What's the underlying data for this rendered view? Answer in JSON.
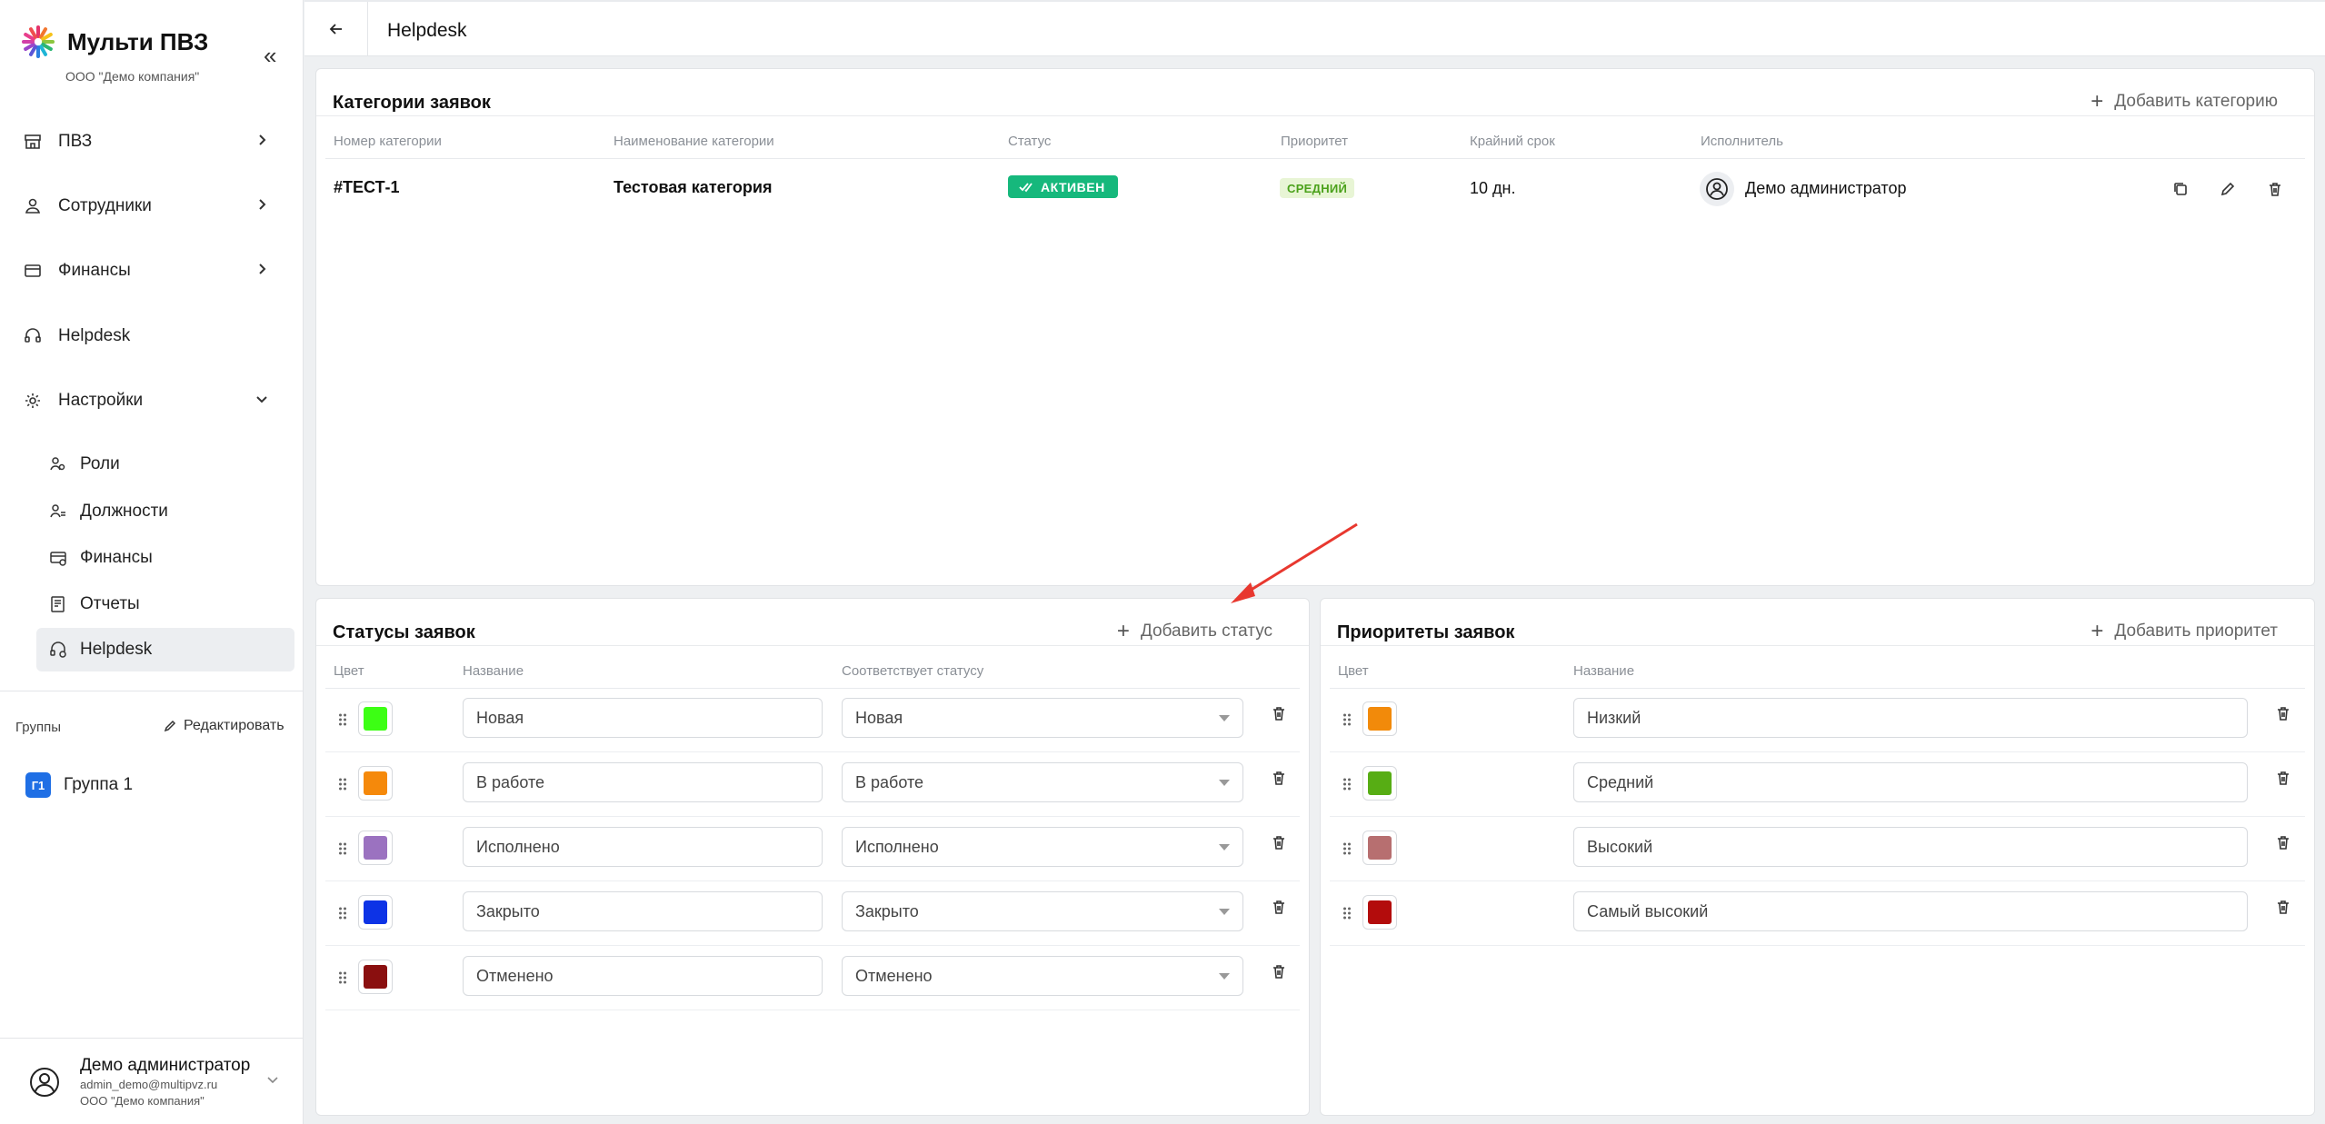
{
  "app": {
    "title": "Мульти ПВЗ",
    "company": "ООО \"Демо компания\""
  },
  "sidebar": {
    "items": [
      {
        "label": "ПВЗ"
      },
      {
        "label": "Сотрудники"
      },
      {
        "label": "Финансы"
      },
      {
        "label": "Helpdesk"
      },
      {
        "label": "Настройки"
      }
    ],
    "settings_items": [
      {
        "label": "Роли"
      },
      {
        "label": "Должности"
      },
      {
        "label": "Финансы"
      },
      {
        "label": "Отчеты"
      },
      {
        "label": "Helpdesk"
      }
    ],
    "groups_label": "Группы",
    "edit_label": "Редактировать",
    "groups": [
      {
        "badge": "Г1",
        "name": "Группа 1"
      }
    ],
    "user": {
      "name": "Демо администратор",
      "email": "admin_demo@multipvz.ru",
      "company": "ООО \"Демо компания\""
    }
  },
  "header": {
    "title": "Helpdesk"
  },
  "categories": {
    "title": "Категории заявок",
    "add_label": "Добавить категорию",
    "columns": [
      "Номер категории",
      "Наименование категории",
      "Статус",
      "Приоритет",
      "Крайний срок",
      "Исполнитель"
    ],
    "rows": [
      {
        "number": "#ТЕСТ-1",
        "name": "Тестовая категория",
        "status": "АКТИВЕН",
        "status_color": "#16b87c",
        "priority": "СРЕДНИЙ",
        "deadline": "10 дн.",
        "executor": "Демо администратор"
      }
    ]
  },
  "statuses": {
    "title": "Статусы заявок",
    "add_label": "Добавить статус",
    "columns": [
      "Цвет",
      "Название",
      "Соответствует статусу"
    ],
    "rows": [
      {
        "color": "#3cff14",
        "name": "Новая",
        "match": "Новая"
      },
      {
        "color": "#f5890b",
        "name": "В работе",
        "match": "В работе"
      },
      {
        "color": "#9b72c0",
        "name": "Исполнено",
        "match": "Исполнено"
      },
      {
        "color": "#0d33e6",
        "name": "Закрыто",
        "match": "Закрыто"
      },
      {
        "color": "#8a0f0f",
        "name": "Отменено",
        "match": "Отменено"
      }
    ]
  },
  "priorities": {
    "title": "Приоритеты заявок",
    "add_label": "Добавить приоритет",
    "columns": [
      "Цвет",
      "Название"
    ],
    "rows": [
      {
        "color": "#f28a0a",
        "name": "Низкий"
      },
      {
        "color": "#57ad14",
        "name": "Средний"
      },
      {
        "color": "#b76f70",
        "name": "Высокий"
      },
      {
        "color": "#b30c0c",
        "name": "Самый высокий"
      }
    ]
  },
  "icons": {
    "logo": "multicolor-flower-icon",
    "annotation": "red-arrow"
  }
}
